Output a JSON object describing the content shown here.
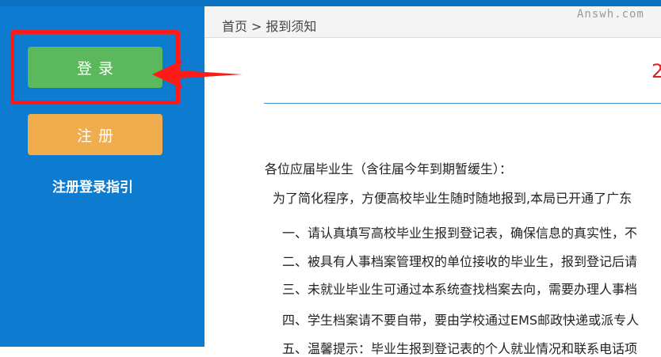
{
  "sidebar": {
    "login_label": "登录",
    "register_label": "注册",
    "guide_link": "注册登录指引"
  },
  "breadcrumb": {
    "home": "首页",
    "separator": ">",
    "current": "报到须知"
  },
  "watermark": "Answh.com",
  "content": {
    "title_fragment": "2",
    "greeting": "各位应届毕业生（含往届今年到期暂缓生）：",
    "intro": "为了简化程序，方便高校毕业生随时随地报到,本局已开通了广东",
    "items": [
      "一、请认真填写高校毕业生报到登记表，确保信息的真实性，不",
      "二、被具有人事档案管理权的单位接收的毕业生，报到登记后请",
      "三、未就业毕业生可通过本系统查找档案去向，需要办理人事档",
      "四、学生档案请不要自带，要由学校通过EMS邮政快递或派专人",
      "五、温馨提示：毕业生报到登记表的个人就业情况和联系电话项"
    ]
  },
  "colors": {
    "sidebar": "#0c7bd0",
    "login": "#5cb85c",
    "register": "#f0ad4e",
    "highlight": "#ff1a1a",
    "title_red": "#e02020"
  }
}
